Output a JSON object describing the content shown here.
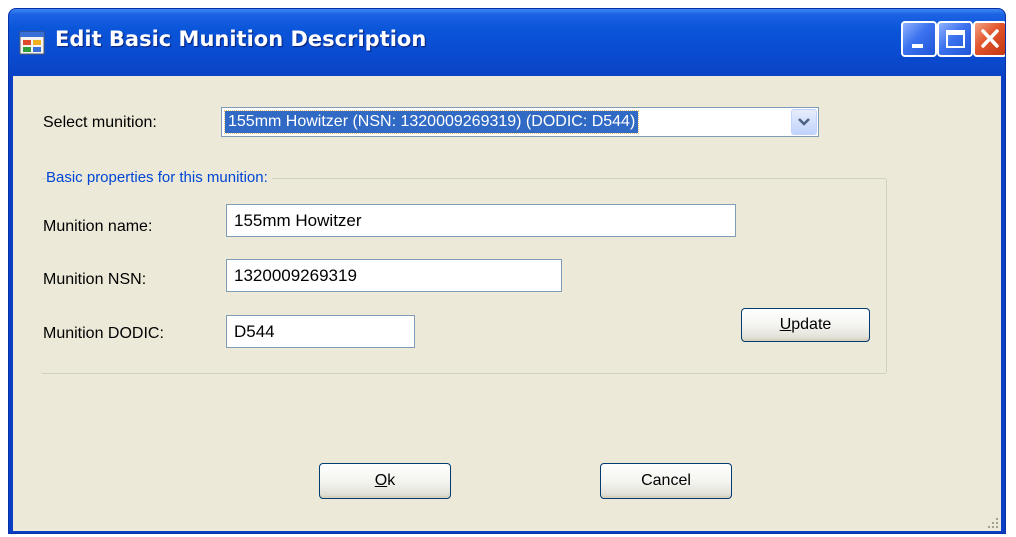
{
  "window": {
    "title": "Edit Basic Munition Description",
    "controls": {
      "minimize": "minimize-icon",
      "maximize": "maximize-icon",
      "close": "close-icon"
    }
  },
  "form": {
    "select_label": "Select munition:",
    "selected_munition": "155mm Howitzer (NSN: 1320009269319) (DODIC: D544)",
    "group_label": "Basic properties for this munition:",
    "fields": {
      "name": {
        "label": "Munition name:",
        "value": "155mm Howitzer"
      },
      "nsn": {
        "label": "Munition NSN:",
        "value": "1320009269319"
      },
      "dodic": {
        "label": "Munition DODIC:",
        "value": "D544"
      }
    },
    "update_button": {
      "mnemonic": "U",
      "rest": "pdate"
    },
    "ok_button": {
      "mnemonic": "O",
      "rest": "k"
    },
    "cancel_button": {
      "label": "Cancel"
    }
  },
  "colors": {
    "titlebar": "#0a55d9",
    "client_background": "#ece9d8",
    "selection": "#316ac5",
    "group_label": "#0046d5",
    "close_button": "#e2542c"
  }
}
